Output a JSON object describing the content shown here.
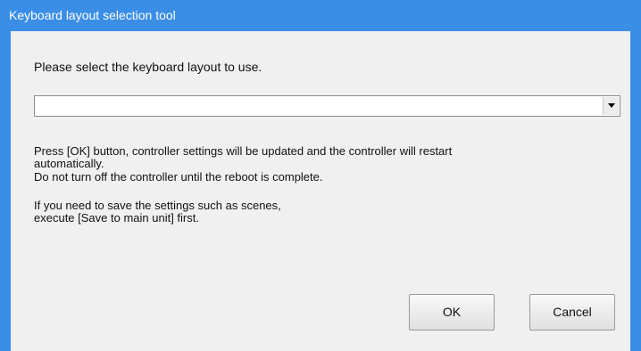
{
  "window": {
    "title": "Keyboard layout selection tool"
  },
  "dialog": {
    "prompt": "Please select the keyboard layout to use.",
    "layout_select": {
      "value": "",
      "icon": "dropdown-arrow-icon"
    },
    "message_line1": "Press [OK] button, controller settings will be updated and the controller will restart",
    "message_line2": "automatically.",
    "message_line3": "Do not turn off the controller until the reboot is complete.",
    "message_line4": "If you need to save the settings such as scenes,",
    "message_line5": "execute [Save to main unit] first.",
    "ok_label": "OK",
    "cancel_label": "Cancel"
  },
  "colors": {
    "titlebar": "#3a8ee6",
    "client_background": "#f0f0f0"
  }
}
